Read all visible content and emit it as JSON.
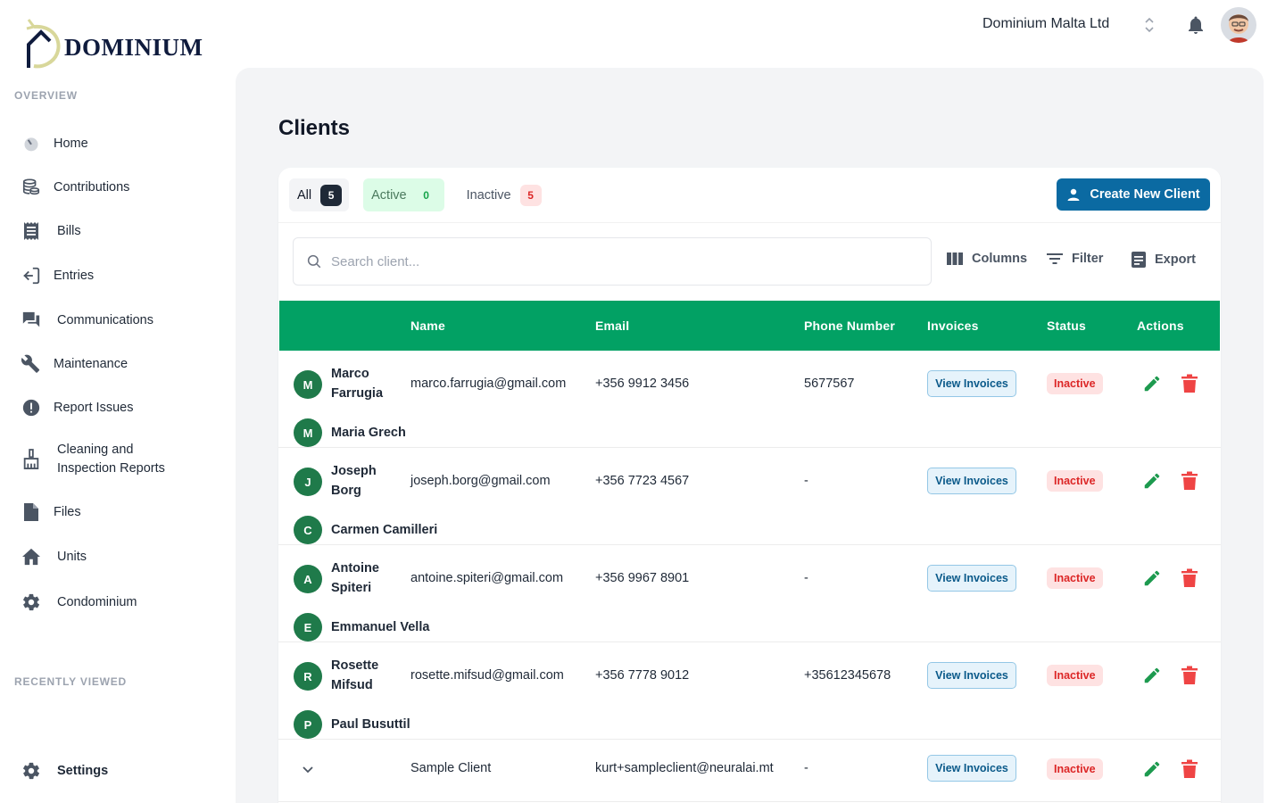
{
  "brand": {
    "name": "DOMINIUM"
  },
  "sidebar": {
    "overview_label": "OVERVIEW",
    "recent_label": "RECENTLY VIEWED",
    "items": [
      {
        "label": "Home",
        "icon": "gauge-icon"
      },
      {
        "label": "Contributions",
        "icon": "coins-icon"
      },
      {
        "label": "Bills",
        "icon": "receipt-icon"
      },
      {
        "label": "Entries",
        "icon": "login-icon"
      },
      {
        "label": "Communications",
        "icon": "chat-icon"
      },
      {
        "label": "Maintenance",
        "icon": "wrench-icon"
      },
      {
        "label": "Report Issues",
        "icon": "alert-icon"
      },
      {
        "label": "Cleaning and Inspection Reports",
        "icon": "broom-icon"
      },
      {
        "label": "Files",
        "icon": "file-icon"
      },
      {
        "label": "Units",
        "icon": "home-icon"
      },
      {
        "label": "Condominium",
        "icon": "gear-icon"
      }
    ],
    "settings_label": "Settings"
  },
  "header": {
    "company": "Dominium Malta Ltd"
  },
  "page": {
    "title": "Clients"
  },
  "tabs": [
    {
      "label": "All",
      "count": "5"
    },
    {
      "label": "Active",
      "count": "0"
    },
    {
      "label": "Inactive",
      "count": "5"
    }
  ],
  "actions": {
    "create_label": "Create New Client"
  },
  "search": {
    "placeholder": "Search client..."
  },
  "toolbar": {
    "columns": "Columns",
    "filter": "Filter",
    "export": "Export"
  },
  "table": {
    "headers": [
      "Name",
      "Email",
      "Phone Number",
      "Invoices",
      "Status",
      "Actions"
    ],
    "rows": [
      {
        "initial": "M",
        "name_line1": "Marco",
        "name_line2": "Farrugia",
        "email": "marco.farrugia@gmail.com",
        "phone": "+356 9912 3456",
        "phone2": "5677567",
        "invoice": "View Invoices",
        "status": "Inactive",
        "sub_initial": "M",
        "sub_name": "Maria Grech"
      },
      {
        "initial": "J",
        "name_line1": "Joseph",
        "name_line2": "Borg",
        "email": "joseph.borg@gmail.com",
        "phone": "+356 7723 4567",
        "phone2": "-",
        "invoice": "View Invoices",
        "status": "Inactive",
        "sub_initial": "C",
        "sub_name": "Carmen Camilleri"
      },
      {
        "initial": "A",
        "name_line1": "Antoine",
        "name_line2": "Spiteri",
        "email": "antoine.spiteri@gmail.com",
        "phone": "+356 9967 8901",
        "phone2": "-",
        "invoice": "View Invoices",
        "status": "Inactive",
        "sub_initial": "E",
        "sub_name": "Emmanuel Vella"
      },
      {
        "initial": "R",
        "name_line1": "Rosette",
        "name_line2": "Mifsud",
        "email": "rosette.mifsud@gmail.com",
        "phone": "+356 7778 9012",
        "phone2": "+35612345678",
        "invoice": "View Invoices",
        "status": "Inactive",
        "sub_initial": "P",
        "sub_name": "Paul Busuttil"
      }
    ],
    "last_row": {
      "name": "Sample Client",
      "email": "kurt+sampleclient@neuralai.mt",
      "phone": "-",
      "invoice": "View Invoices",
      "status": "Inactive"
    }
  },
  "colors": {
    "accent_green": "#02a164",
    "primary_blue": "#0b6aa2",
    "danger_red": "#dc2626"
  }
}
